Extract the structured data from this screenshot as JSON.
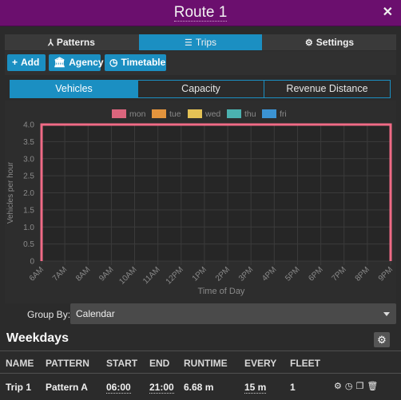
{
  "header": {
    "title": "Route 1"
  },
  "tabs": [
    {
      "label": "Patterns"
    },
    {
      "label": "Trips"
    },
    {
      "label": "Settings"
    }
  ],
  "toolbar": {
    "add_label": "Add",
    "agency_label": "Agency",
    "timetable_label": "Timetable"
  },
  "subtabs": [
    {
      "label": "Vehicles"
    },
    {
      "label": "Capacity"
    },
    {
      "label": "Revenue Distance"
    }
  ],
  "chart_data": {
    "type": "line",
    "xlabel": "Time of Day",
    "ylabel": "Vehicles per hour",
    "ylim": [
      0,
      4
    ],
    "y_ticks": [
      "0",
      "0.5",
      "1.0",
      "1.5",
      "2.0",
      "2.5",
      "3.0",
      "3.5",
      "4.0"
    ],
    "categories": [
      "6AM",
      "7AM",
      "8AM",
      "9AM",
      "10AM",
      "11AM",
      "12PM",
      "1PM",
      "2PM",
      "3PM",
      "4PM",
      "5PM",
      "6PM",
      "7PM",
      "8PM",
      "9PM"
    ],
    "grid": true,
    "legend_position": "top-center",
    "series": [
      {
        "name": "mon",
        "color": "#f06b86",
        "values": [
          4,
          4,
          4,
          4,
          4,
          4,
          4,
          4,
          4,
          4,
          4,
          4,
          4,
          4,
          4,
          4
        ]
      },
      {
        "name": "tue",
        "color": "#f7a03f",
        "values": []
      },
      {
        "name": "wed",
        "color": "#f8d35a",
        "values": []
      },
      {
        "name": "thu",
        "color": "#4fc1bf",
        "values": []
      },
      {
        "name": "fri",
        "color": "#3d9ee6",
        "values": []
      }
    ]
  },
  "group_by": {
    "label": "Group By:",
    "value": "Calendar"
  },
  "section": {
    "title": "Weekdays"
  },
  "table": {
    "headers": [
      "NAME",
      "PATTERN",
      "START",
      "END",
      "RUNTIME",
      "EVERY",
      "FLEET"
    ],
    "rows": [
      {
        "name": "Trip 1",
        "pattern": "Pattern A",
        "start": "06:00",
        "end": "21:00",
        "runtime": "6.68 m",
        "every": "15 m",
        "fleet": "1"
      }
    ]
  },
  "icons": {
    "close": "close-icon",
    "patterns": "pattern-icon",
    "trips": "list-icon",
    "settings": "gear-icon",
    "add": "plus-icon",
    "agency": "bank-icon",
    "timetable": "clock-icon"
  },
  "colors": {
    "titlebar": "#6b0f6e",
    "accent": "#1b8fc2"
  }
}
